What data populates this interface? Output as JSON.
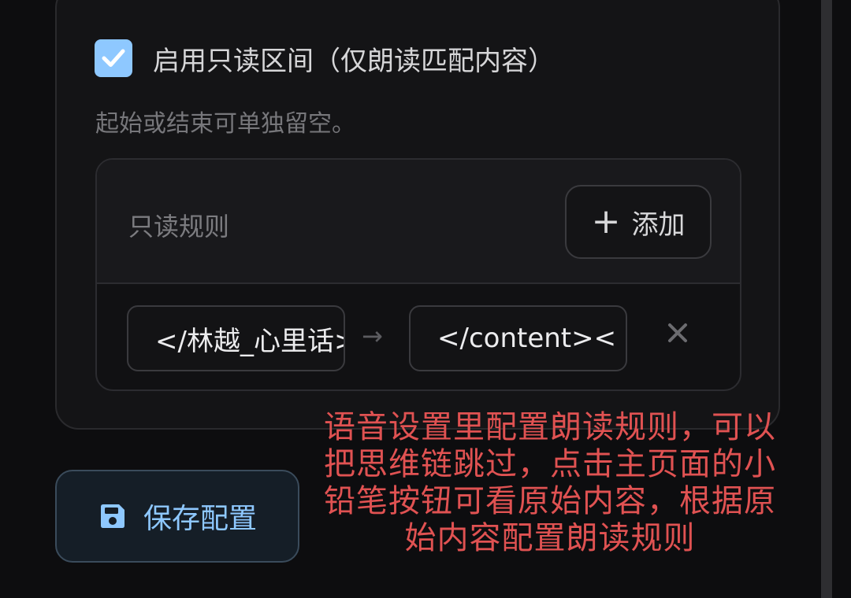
{
  "settings": {
    "readonly_toggle": {
      "label": "启用只读区间（仅朗读匹配内容）",
      "checked": true
    },
    "hint": "起始或结束可单独留空。",
    "rules": {
      "title": "只读规则",
      "add_label": "添加",
      "items": [
        {
          "start": "</林越_心里话>",
          "arrow": "→",
          "end": "</content><",
          "delete_icon": "close-icon"
        }
      ]
    }
  },
  "save_button": {
    "label": "保存配置",
    "icon": "floppy-disk-icon"
  },
  "annotation": "语音设置里配置朗读规则，可以把思维链跳过，点击主页面的小铅笔按钮可看原始内容，根据原始内容配置朗读规则",
  "colors": {
    "accent": "#8ec8ff",
    "annotation": "#e05252"
  }
}
